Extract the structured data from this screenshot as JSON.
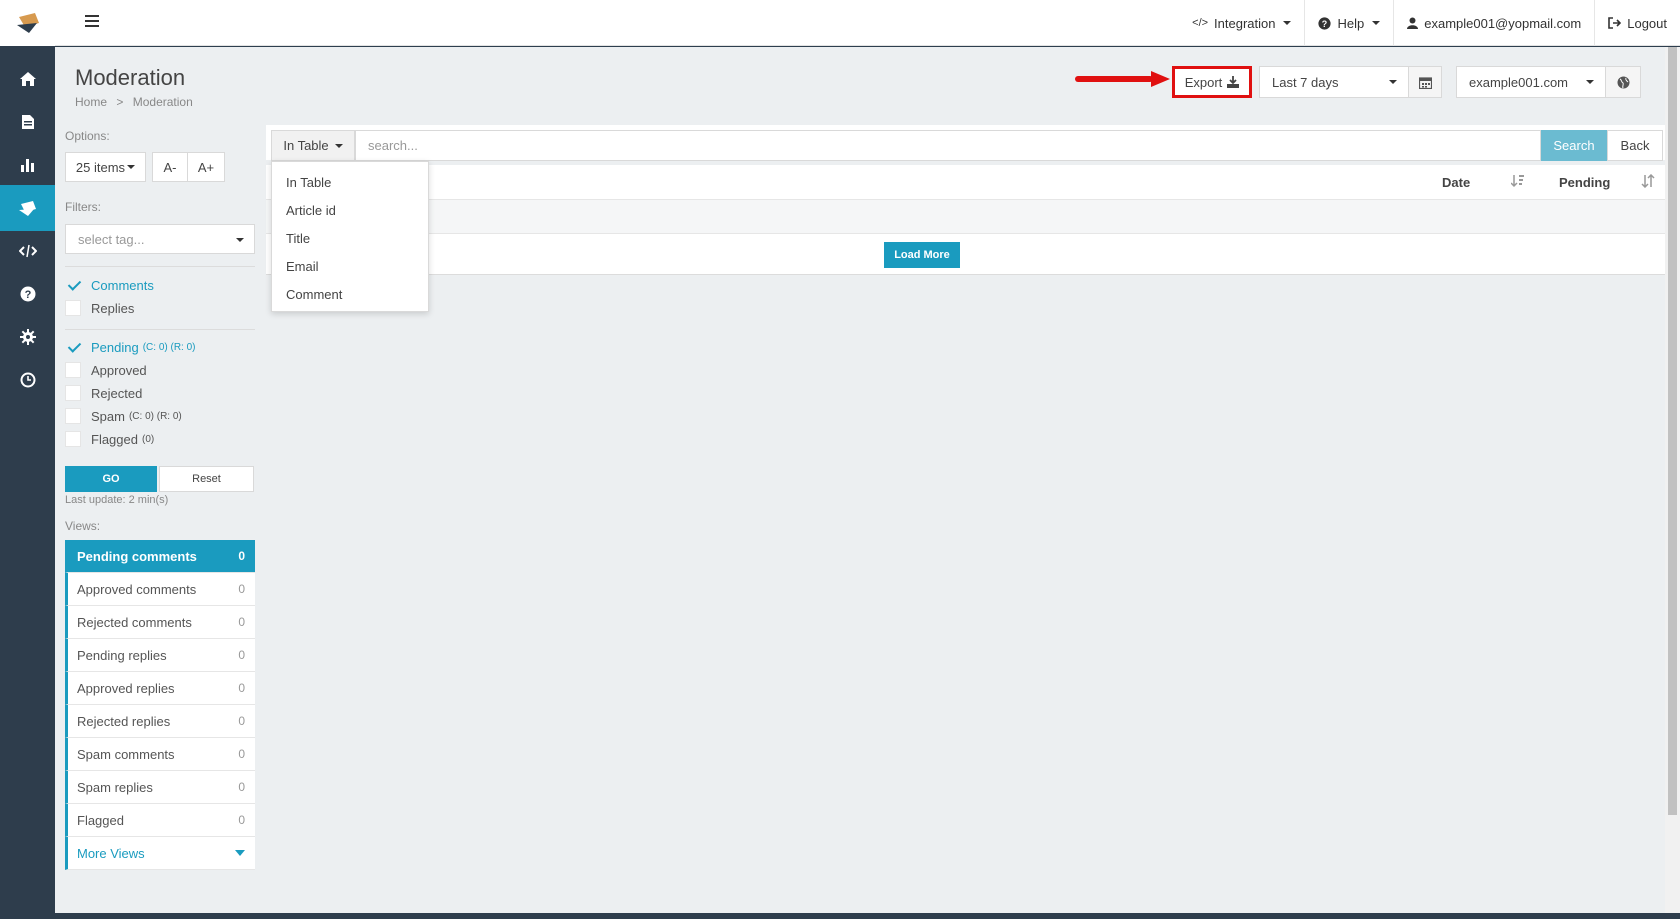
{
  "topbar": {
    "integration": "Integration",
    "help": "Help",
    "user_email": "example001@yopmail.com",
    "logout": "Logout"
  },
  "rail": {
    "icons": [
      "home-icon",
      "document-icon",
      "bar-chart-icon",
      "moderation-icon",
      "code-icon",
      "question-icon",
      "gear-icon",
      "clock-icon"
    ],
    "active": "moderation-icon"
  },
  "header": {
    "title": "Moderation",
    "breadcrumb_home": "Home",
    "breadcrumb_sep": ">",
    "breadcrumb_current": "Moderation",
    "export_label": "Export",
    "date_range": "Last 7 days",
    "site": "example001.com"
  },
  "options": {
    "label": "Options:",
    "items_per_page": "25 items",
    "font_smaller": "A-",
    "font_larger": "A+"
  },
  "filters": {
    "label": "Filters:",
    "tag_placeholder": "select tag...",
    "type": [
      {
        "label": "Comments",
        "checked": true
      },
      {
        "label": "Replies",
        "checked": false
      }
    ],
    "status": [
      {
        "label": "Pending",
        "count": "(C: 0) (R: 0)",
        "checked": true
      },
      {
        "label": "Approved",
        "count": "",
        "checked": false
      },
      {
        "label": "Rejected",
        "count": "",
        "checked": false
      },
      {
        "label": "Spam",
        "count": "(C: 0) (R: 0)",
        "checked": false
      },
      {
        "label": "Flagged",
        "count": "(0)",
        "checked": false
      }
    ],
    "go": "GO",
    "reset": "Reset",
    "last_update": "Last update: 2 min(s)"
  },
  "views": {
    "label": "Views:",
    "items": [
      {
        "label": "Pending comments",
        "count": "0"
      },
      {
        "label": "Approved comments",
        "count": "0"
      },
      {
        "label": "Rejected comments",
        "count": "0"
      },
      {
        "label": "Pending replies",
        "count": "0"
      },
      {
        "label": "Approved replies",
        "count": "0"
      },
      {
        "label": "Rejected replies",
        "count": "0"
      },
      {
        "label": "Spam comments",
        "count": "0"
      },
      {
        "label": "Spam replies",
        "count": "0"
      },
      {
        "label": "Flagged",
        "count": "0"
      }
    ],
    "more": "More Views"
  },
  "search": {
    "scope": "In Table",
    "placeholder": "search...",
    "search_btn": "Search",
    "back_btn": "Back",
    "scope_options": [
      "In Table",
      "Article id",
      "Title",
      "Email",
      "Comment"
    ]
  },
  "table": {
    "col_date": "Date",
    "col_pending": "Pending",
    "load_more": "Load More"
  },
  "colors": {
    "accent": "#1a9bbf",
    "rail": "#2e3d4c",
    "highlight": "#e01010"
  }
}
